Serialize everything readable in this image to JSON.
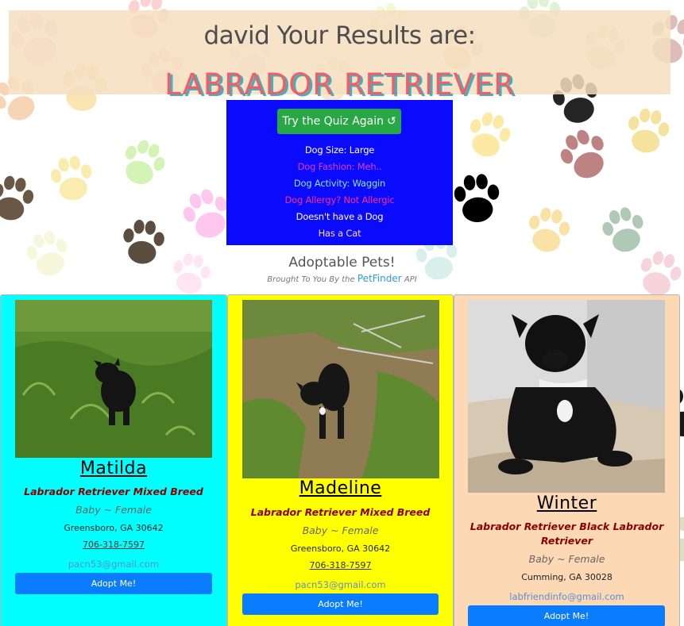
{
  "header": {
    "greeting": "david Your Results are:",
    "breed": "LABRADOR RETRIEVER"
  },
  "quiz": {
    "retry_label": "Try the Quiz Again",
    "retry_icon": "↺",
    "answers": [
      {
        "text": "Dog Size: Large",
        "color": "#ffffff"
      },
      {
        "text": "Dog Fashion: Meh..",
        "color": "#e13bd6"
      },
      {
        "text": "Dog Activity: Waggin",
        "color": "#8fe3ff"
      },
      {
        "text": "Dog Allergy? Not Allergic",
        "color": "#ff2d8c"
      },
      {
        "text": "Doesn't have a Dog",
        "color": "#ffffff"
      },
      {
        "text": "Has a Cat",
        "color": "#ffd6f5"
      }
    ]
  },
  "adoptable": {
    "heading": "Adoptable Pets!",
    "source_prefix": "Brought To You By the",
    "source_link": "PetFinder",
    "source_suffix": "API"
  },
  "pets": [
    {
      "name": "Matilda",
      "breed": "Labrador Retriever Mixed Breed",
      "age_gender": "Baby ~ Female",
      "location": "Greensboro, GA 30642",
      "phone": "706-318-7597",
      "email": "pacn53@gmail.com",
      "adopt_label": "Adopt Me!",
      "card_color": "#00ffff"
    },
    {
      "name": "Madeline",
      "breed": "Labrador Retriever Mixed Breed",
      "age_gender": "Baby ~ Female",
      "location": "Greensboro, GA 30642",
      "phone": "706-318-7597",
      "email": "pacn53@gmail.com",
      "adopt_label": "Adopt Me!",
      "card_color": "#ffff00"
    },
    {
      "name": "Winter",
      "breed": "Labrador Retriever Black Labrador Retriever",
      "age_gender": "Baby ~ Female",
      "location": "Cumming, GA 30028",
      "phone": "",
      "email": "labfriendinfo@gmail.com",
      "adopt_label": "Adopt Me!",
      "card_color": "#fdd8b5"
    }
  ],
  "colors": {
    "retry_button": "#28a745",
    "quiz_box": "#0a0afc",
    "adopt_button": "#0a7cff",
    "breed_text": "#ee5f6a",
    "breed_shadow": "#43b1bd"
  }
}
